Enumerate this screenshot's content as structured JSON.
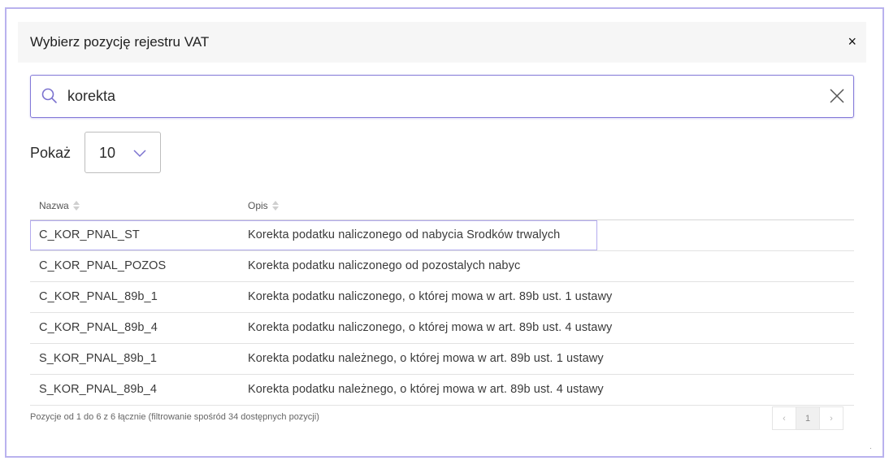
{
  "dialog": {
    "title": "Wybierz pozycję rejestru VAT",
    "close_label": "×"
  },
  "search": {
    "value": "korekta",
    "placeholder": ""
  },
  "page_size": {
    "label": "Pokaż",
    "value": "10"
  },
  "table": {
    "columns": [
      "Nazwa",
      "Opis"
    ],
    "rows": [
      {
        "name": "C_KOR_PNAL_ST",
        "description": "Korekta podatku naliczonego od nabycia Srodków trwalych"
      },
      {
        "name": "C_KOR_PNAL_POZOS",
        "description": "Korekta podatku naliczonego od pozostalych nabyc"
      },
      {
        "name": "C_KOR_PNAL_89b_1",
        "description": "Korekta podatku naliczonego, o której mowa w art. 89b ust. 1 ustawy"
      },
      {
        "name": "C_KOR_PNAL_89b_4",
        "description": "Korekta podatku naliczonego, o której mowa w art. 89b ust. 4 ustawy"
      },
      {
        "name": "S_KOR_PNAL_89b_1",
        "description": "Korekta podatku należnego, o której mowa w art. 89b ust. 1 ustawy"
      },
      {
        "name": "S_KOR_PNAL_89b_4",
        "description": "Korekta podatku należnego, o której mowa w art. 89b ust. 4 ustawy"
      }
    ]
  },
  "footer": {
    "info": "Pozycje od 1 do 6 z 6 łącznie (filtrowanie spośród 34 dostępnych pozycji)",
    "pagination": {
      "prev": "‹",
      "current": "1",
      "next": "›"
    }
  },
  "colors": {
    "accent": "#8379d8",
    "highlight_border": "#b3abee",
    "header_bg": "#f6f6f6"
  }
}
